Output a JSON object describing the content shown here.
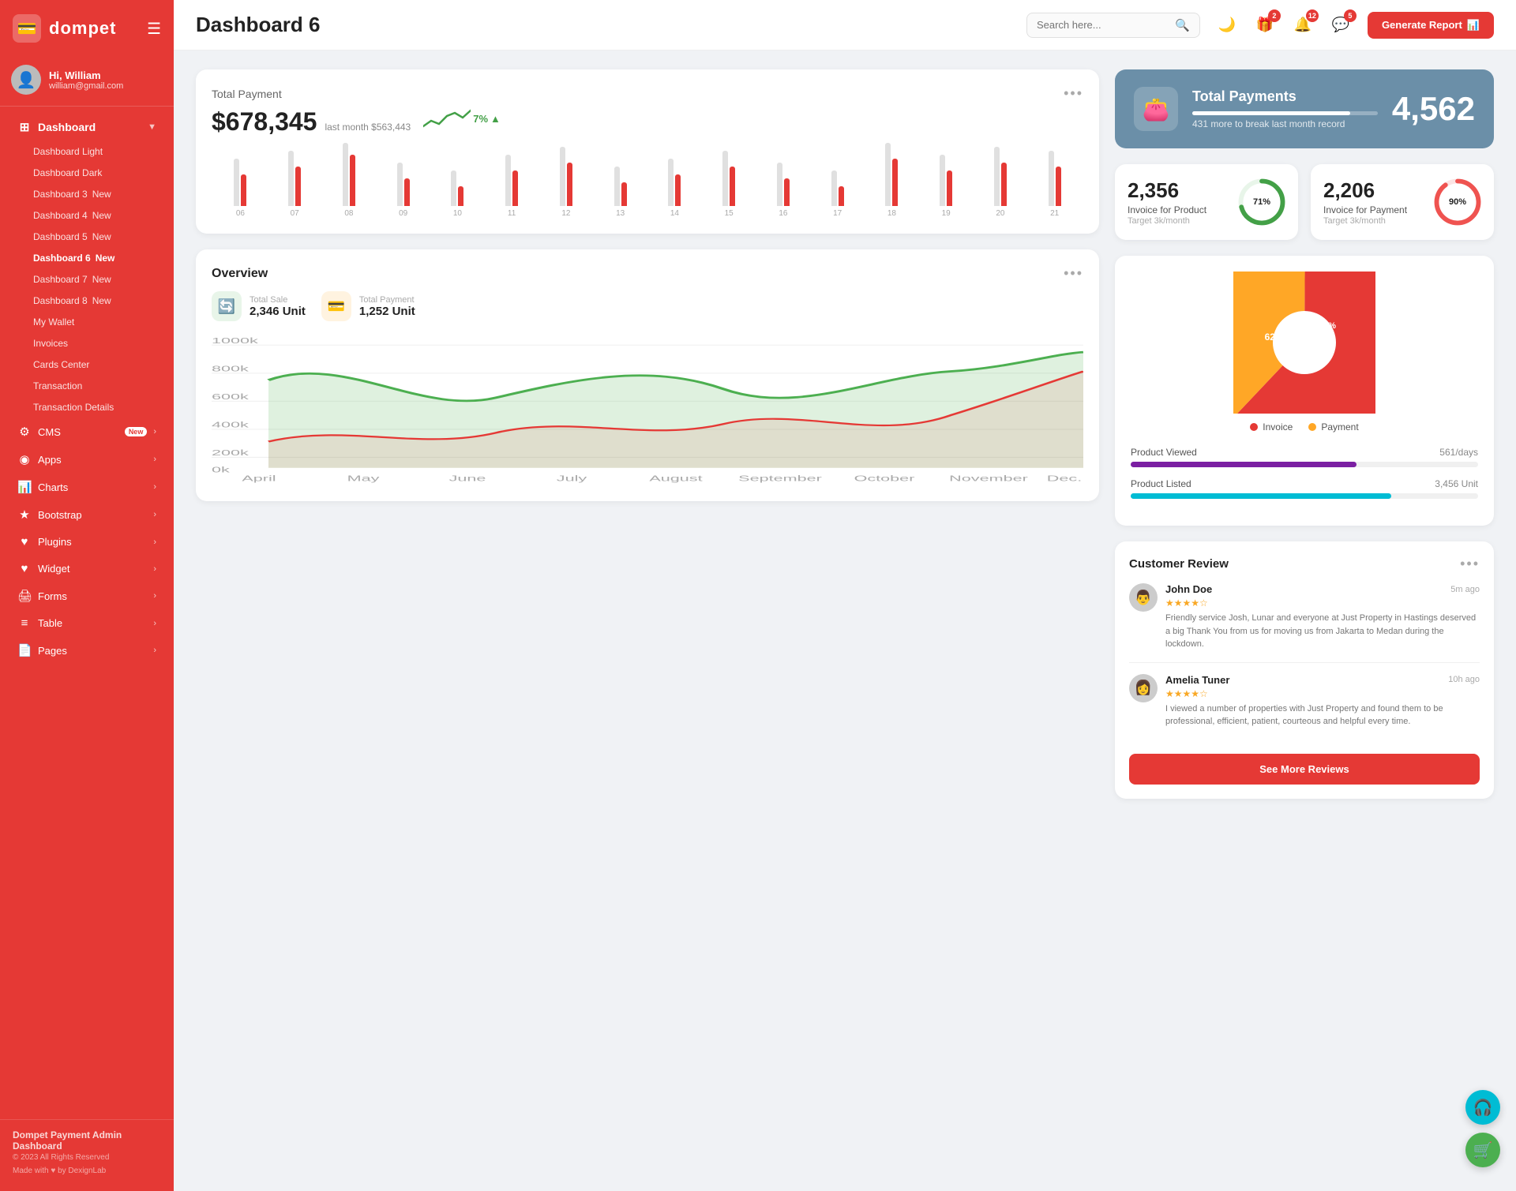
{
  "brand": {
    "logo_text": "dompet",
    "logo_icon": "💳"
  },
  "user": {
    "name": "Hi, William",
    "email": "william@gmail.com",
    "avatar_char": "👤"
  },
  "sidebar": {
    "dashboard_label": "Dashboard",
    "nav_items": [
      {
        "id": "dashboard-light",
        "label": "Dashboard Light",
        "icon": "",
        "sub": true,
        "badge": ""
      },
      {
        "id": "dashboard-dark",
        "label": "Dashboard Dark",
        "icon": "",
        "sub": true,
        "badge": ""
      },
      {
        "id": "dashboard-3",
        "label": "Dashboard 3",
        "icon": "",
        "sub": true,
        "badge": "New"
      },
      {
        "id": "dashboard-4",
        "label": "Dashboard 4",
        "icon": "",
        "sub": true,
        "badge": "New"
      },
      {
        "id": "dashboard-5",
        "label": "Dashboard 5",
        "icon": "",
        "sub": true,
        "badge": "New"
      },
      {
        "id": "dashboard-6",
        "label": "Dashboard 6",
        "icon": "",
        "sub": true,
        "badge": "New",
        "active": true
      },
      {
        "id": "dashboard-7",
        "label": "Dashboard 7",
        "icon": "",
        "sub": true,
        "badge": "New"
      },
      {
        "id": "dashboard-8",
        "label": "Dashboard 8",
        "icon": "",
        "sub": true,
        "badge": "New"
      },
      {
        "id": "my-wallet",
        "label": "My Wallet",
        "icon": "",
        "sub": true,
        "badge": ""
      },
      {
        "id": "invoices",
        "label": "Invoices",
        "icon": "",
        "sub": true,
        "badge": ""
      },
      {
        "id": "cards-center",
        "label": "Cards Center",
        "icon": "",
        "sub": true,
        "badge": ""
      },
      {
        "id": "transaction",
        "label": "Transaction",
        "icon": "",
        "sub": true,
        "badge": ""
      },
      {
        "id": "transaction-details",
        "label": "Transaction Details",
        "icon": "",
        "sub": true,
        "badge": ""
      }
    ],
    "menu_items": [
      {
        "id": "cms",
        "label": "CMS",
        "icon": "⚙",
        "badge": "New",
        "arrow": true
      },
      {
        "id": "apps",
        "label": "Apps",
        "icon": "◉",
        "badge": "",
        "arrow": true
      },
      {
        "id": "charts",
        "label": "Charts",
        "icon": "📊",
        "badge": "",
        "arrow": true
      },
      {
        "id": "bootstrap",
        "label": "Bootstrap",
        "icon": "★",
        "badge": "",
        "arrow": true
      },
      {
        "id": "plugins",
        "label": "Plugins",
        "icon": "♥",
        "badge": "",
        "arrow": true
      },
      {
        "id": "widget",
        "label": "Widget",
        "icon": "♥",
        "badge": "",
        "arrow": true
      },
      {
        "id": "forms",
        "label": "Forms",
        "icon": "🖨",
        "badge": "",
        "arrow": true
      },
      {
        "id": "table",
        "label": "Table",
        "icon": "≡",
        "badge": "",
        "arrow": true
      },
      {
        "id": "pages",
        "label": "Pages",
        "icon": "📄",
        "badge": "",
        "arrow": true
      }
    ],
    "footer": {
      "brand": "Dompet Payment Admin Dashboard",
      "copy": "© 2023 All Rights Reserved",
      "made": "Made with ♥ by DexignLab"
    }
  },
  "header": {
    "title": "Dashboard 6",
    "search_placeholder": "Search here...",
    "icons": [
      {
        "id": "theme-toggle",
        "icon": "🌙",
        "badge": ""
      },
      {
        "id": "gift-icon",
        "icon": "🎁",
        "badge": "2"
      },
      {
        "id": "bell-icon",
        "icon": "🔔",
        "badge": "12"
      },
      {
        "id": "chat-icon",
        "icon": "💬",
        "badge": "5"
      }
    ],
    "btn_generate": "Generate Report"
  },
  "total_payment": {
    "card_title": "Total Payment",
    "amount": "$678,345",
    "last_month": "last month $563,443",
    "change": "7%",
    "bars": [
      {
        "label": "06",
        "grey": 60,
        "red": 40
      },
      {
        "label": "07",
        "grey": 70,
        "red": 50
      },
      {
        "label": "08",
        "grey": 80,
        "red": 65
      },
      {
        "label": "09",
        "grey": 55,
        "red": 35
      },
      {
        "label": "10",
        "grey": 45,
        "red": 25
      },
      {
        "label": "11",
        "grey": 65,
        "red": 45
      },
      {
        "label": "12",
        "grey": 75,
        "red": 55
      },
      {
        "label": "13",
        "grey": 50,
        "red": 30
      },
      {
        "label": "14",
        "grey": 60,
        "red": 40
      },
      {
        "label": "15",
        "grey": 70,
        "red": 50
      },
      {
        "label": "16",
        "grey": 55,
        "red": 35
      },
      {
        "label": "17",
        "grey": 45,
        "red": 25
      },
      {
        "label": "18",
        "grey": 80,
        "red": 60
      },
      {
        "label": "19",
        "grey": 65,
        "red": 45
      },
      {
        "label": "20",
        "grey": 75,
        "red": 55
      },
      {
        "label": "21",
        "grey": 70,
        "red": 50
      }
    ]
  },
  "hero_card": {
    "icon": "👛",
    "label": "Total Payments",
    "sub": "431 more to break last month record",
    "value": "4,562",
    "progress": 85
  },
  "invoice_product": {
    "value": "2,356",
    "label": "Invoice for Product",
    "target": "Target 3k/month",
    "percent": 71,
    "color": "#43a047"
  },
  "invoice_payment": {
    "value": "2,206",
    "label": "Invoice for Payment",
    "target": "Target 3k/month",
    "percent": 90,
    "color": "#ef5350"
  },
  "overview": {
    "title": "Overview",
    "total_sale_label": "Total Sale",
    "total_sale_value": "2,346 Unit",
    "total_payment_label": "Total Payment",
    "total_payment_value": "1,252 Unit",
    "months": [
      "April",
      "May",
      "June",
      "July",
      "August",
      "September",
      "October",
      "November",
      "Dec."
    ],
    "y_labels": [
      "1000k",
      "800k",
      "600k",
      "400k",
      "200k",
      "0k"
    ]
  },
  "pie_chart": {
    "invoice_pct": 62,
    "payment_pct": 38,
    "invoice_label": "Invoice",
    "payment_label": "Payment",
    "invoice_color": "#e53935",
    "payment_color": "#ffa726"
  },
  "product_stats": {
    "viewed_label": "Product Viewed",
    "viewed_value": "561/days",
    "viewed_color": "#7b1fa2",
    "viewed_pct": 65,
    "listed_label": "Product Listed",
    "listed_value": "3,456 Unit",
    "listed_color": "#00bcd4",
    "listed_pct": 75
  },
  "customer_review": {
    "title": "Customer Review",
    "reviews": [
      {
        "name": "John Doe",
        "time": "5m ago",
        "stars": 4,
        "text": "Friendly service Josh, Lunar and everyone at Just Property in Hastings deserved a big Thank You from us for moving us from Jakarta to Medan during the lockdown.",
        "avatar_char": "👨"
      },
      {
        "name": "Amelia Tuner",
        "time": "10h ago",
        "stars": 4,
        "text": "I viewed a number of properties with Just Property and found them to be professional, efficient, patient, courteous and helpful every time.",
        "avatar_char": "👩"
      }
    ],
    "btn_more": "See More Reviews"
  },
  "fab": {
    "support_icon": "🎧",
    "cart_icon": "🛒"
  }
}
